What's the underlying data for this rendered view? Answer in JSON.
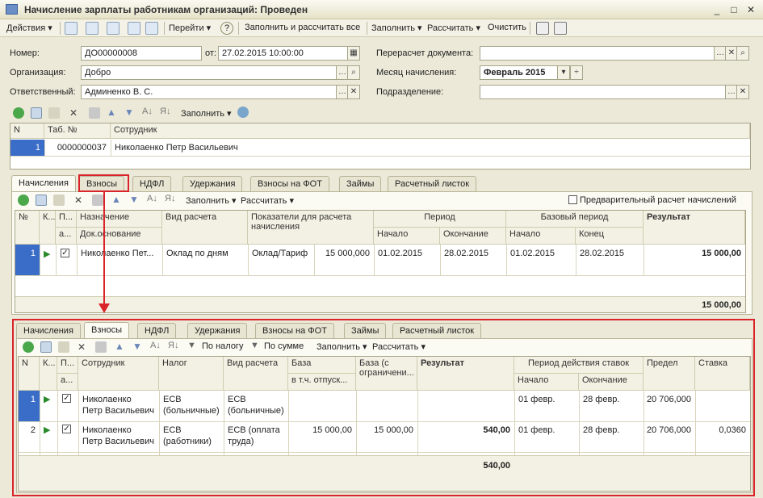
{
  "window": {
    "title": "Начисление зарплаты работникам организаций: Проведен",
    "minimize": "_",
    "maximize": "□",
    "close": "✕"
  },
  "toolbar": {
    "actions": "Действия ▾",
    "goto": "Перейти ▾",
    "help": "?",
    "fill_calc_all": "Заполнить и рассчитать все",
    "fill": "Заполнить ▾",
    "calculate": "Рассчитать ▾",
    "clear": "Очистить"
  },
  "header": {
    "number_label": "Номер:",
    "number_value": "ДО00000008",
    "from_label": "от:",
    "date_value": "27.02.2015 10:00:00",
    "org_label": "Организация:",
    "org_value": "Добро",
    "resp_label": "Ответственный:",
    "resp_value": "Админенко В. С.",
    "recalc_label": "Перерасчет документа:",
    "recalc_value": "",
    "month_label": "Месяц начисления:",
    "month_value": "Февраль 2015",
    "dept_label": "Подразделение:",
    "dept_value": ""
  },
  "employees": {
    "fill_label": "Заполнить ▾",
    "columns": [
      "N",
      "Таб. №",
      "Сотрудник"
    ],
    "rows": [
      {
        "n": "1",
        "tab": "0000000037",
        "name": "Николаенко Петр Васильевич"
      }
    ]
  },
  "tabs1": [
    "Начисления",
    "Взносы",
    "НДФЛ",
    "Удержания",
    "Взносы на ФОТ",
    "Займы",
    "Расчетный листок"
  ],
  "accruals": {
    "fill_label": "Заполнить ▾",
    "calc_label": "Рассчитать ▾",
    "prelim_label": "Предварительный расчет начислений",
    "col_n": "№",
    "col_k": "К...",
    "col_p": "П...",
    "col_pa": "а...",
    "col_name": "Назначение",
    "col_basis": "Док.основание",
    "col_type": "Вид расчета",
    "col_indicators": "Показатели для расчета начисления",
    "col_period": "Период",
    "col_start": "Начало",
    "col_end": "Окончание",
    "col_baseperiod": "Базовый период",
    "col_bstart": "Начало",
    "col_bend": "Конец",
    "col_result": "Результат",
    "row": {
      "n": "1",
      "name": "Николаенко Пет...",
      "type": "Оклад по дням",
      "indicator": "Оклад/Тариф",
      "amount": "15 000,000",
      "start": "01.02.2015",
      "end": "28.02.2015",
      "bstart": "01.02.2015",
      "bend": "28.02.2015",
      "result": "15 000,00"
    },
    "total": "15 000,00"
  },
  "tabs2": [
    "Начисления",
    "Взносы",
    "НДФЛ",
    "Удержания",
    "Взносы на ФОТ",
    "Займы",
    "Расчетный листок"
  ],
  "contrib": {
    "by_tax": "По налогу",
    "by_sum": "По сумме",
    "fill_label": "Заполнить ▾",
    "calc_label": "Рассчитать ▾",
    "col_n": "N",
    "col_k": "К...",
    "col_p": "П...",
    "col_pa": "а...",
    "col_emp": "Сотрудник",
    "col_tax": "Налог",
    "col_type": "Вид расчета",
    "col_base": "База",
    "col_base_sub": "в т.ч. отпуск...",
    "col_base_lim": "База (с ограничени...",
    "col_result": "Результат",
    "col_period": "Период действия ставок",
    "col_start": "Начало",
    "col_end": "Окончание",
    "col_limit": "Предел",
    "col_rate": "Ставка",
    "rows": [
      {
        "n": "1",
        "emp1": "Николаенко",
        "emp2": "Петр Васильевич",
        "tax1": "ЕСВ",
        "tax2": "(больничные)",
        "type1": "ЕСВ",
        "type2": "(больничные)",
        "base": "",
        "base_lim": "",
        "result": "",
        "start": "01 февр.",
        "end": "28 февр.",
        "limit": "20 706,000",
        "rate": ""
      },
      {
        "n": "2",
        "emp1": "Николаенко",
        "emp2": "Петр Васильевич",
        "tax1": "ЕСВ",
        "tax2": "(работники)",
        "type1": "ЕСВ (оплата",
        "type2": "труда)",
        "base": "15 000,00",
        "base_lim": "15 000,00",
        "result": "540,00",
        "start": "01 февр.",
        "end": "28 февр.",
        "limit": "20 706,000",
        "rate": "0,0360"
      }
    ],
    "total": "540,00"
  },
  "colors": {
    "accent_red": "#d9242a"
  }
}
